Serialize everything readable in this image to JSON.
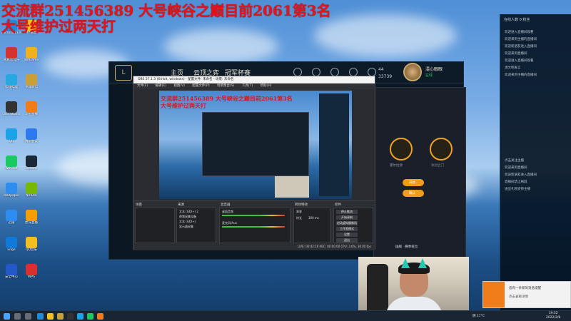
{
  "overlay": {
    "line1": "交流群251456389 大号峡谷之巅目前2061第3名",
    "line2": "大号维护过两天打"
  },
  "desktop_icons": [
    {
      "label": "Microsoft Edge",
      "color": "#1f8ad8"
    },
    {
      "label": "YY语音",
      "color": "#f5c21c"
    },
    {
      "label": "网易云音乐",
      "color": "#d93030"
    },
    {
      "label": "WeGame",
      "color": "#f0b020"
    },
    {
      "label": "哔哩哔哩",
      "color": "#28a8e0"
    },
    {
      "label": "英雄联盟",
      "color": "#c8a03a"
    },
    {
      "label": "OBS Studio",
      "color": "#333333"
    },
    {
      "label": "斗鱼直播",
      "color": "#f07d1a"
    },
    {
      "label": "QQ",
      "color": "#1aa3e8"
    },
    {
      "label": "腾讯会议",
      "color": "#2d7af0"
    },
    {
      "label": "WeChat",
      "color": "#1ac95f"
    },
    {
      "label": "Steam",
      "color": "#1b2838"
    },
    {
      "label": "Wallpaper",
      "color": "#2f8df0"
    },
    {
      "label": "NVIDIA",
      "color": "#76b900"
    },
    {
      "label": "迅雷",
      "color": "#2d8df0"
    },
    {
      "label": "虎牙直播",
      "color": "#f5a000"
    },
    {
      "label": "Edge",
      "color": "#0f7ad8"
    },
    {
      "label": "QQ音乐",
      "color": "#f0c020"
    },
    {
      "label": "安全中心",
      "color": "#2258c8"
    },
    {
      "label": "WPS",
      "color": "#d92f2f"
    }
  ],
  "lol": {
    "logo": "L",
    "nav": [
      "主页",
      "云顶之弈",
      "冠军杯赛"
    ],
    "top_icons": [
      "商店",
      "收藏",
      "宝箱",
      "战利品",
      "设置"
    ],
    "rp": "44",
    "be": "33739",
    "username": "混心眼眼",
    "status": "在线"
  },
  "panel": {
    "label_left": "霍尔拉德",
    "label_right": "冰封之门",
    "btn1": "开始",
    "btn2": "确认",
    "footer": "国服 · 赛季排位"
  },
  "obs": {
    "title": "OBS 27.1.3 (64-bit, windows) - 配置文件: 未命名 - 场景: 未命名",
    "menu": [
      "文件(F)",
      "编辑(E)",
      "视图(V)",
      "配置文件(P)",
      "场景集合(S)",
      "工具(T)",
      "帮助(H)"
    ],
    "docks": {
      "scenes": "场景",
      "sources": "来源",
      "mixer": "混音器",
      "transitions": "转场特效",
      "controls": "控件"
    },
    "source_items": [
      "文本 (GDI+) 2",
      "视频采集设备",
      "文本 (GDI+)",
      "显示器采集"
    ],
    "mixer_items": [
      "桌面音频",
      "麦克风/Aux"
    ],
    "transition_value": "渐变",
    "duration_label": "时长",
    "duration_value": "300 ms",
    "control_buttons": [
      "停止推流",
      "开始录制",
      "启动虚拟摄像机",
      "工作室模式",
      "设置",
      "退出"
    ],
    "status": "LIVE: 00:42:16  REC: 00:00:00  CPU: 3.6%, 30.00 fps"
  },
  "chat": {
    "header": "在线人数 0  粉丝",
    "lines": [
      "欢迎进入直播间观看",
      "欢迎来到主播的直播间",
      "欢迎新朋友进入直播间",
      "欢迎来到直播间",
      "欢迎进入直播间观看",
      "请文明发言",
      "欢迎来到主播的直播间",
      "点击关注主播",
      "欢迎来到直播间",
      "欢迎新朋友进入直播间",
      "直播间禁止刷屏",
      "送出礼物支持主播"
    ]
  },
  "notify": {
    "title": "您有一条新的消息提醒",
    "sub": "点击查看详情"
  },
  "taskbar": {
    "weather": "阴 17°C",
    "time": "19:52",
    "date": "2022/2/8"
  },
  "colors": {
    "overlay_red": "#e4141b",
    "lol_gold": "#c8aa6e",
    "panel_orange": "#f29b1c"
  }
}
